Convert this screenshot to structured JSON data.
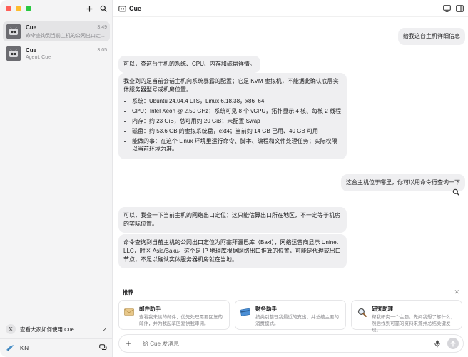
{
  "app": {
    "title": "Cue"
  },
  "sidebar": {
    "conversations": [
      {
        "title": "Cue",
        "time": "3:49",
        "preview": "命令查询到当前主机的公网出口定..."
      },
      {
        "title": "Cue",
        "time": "3:05",
        "preview": "Agent: Cue"
      }
    ],
    "share_link": {
      "label": "查看大家如何使用 Cue"
    },
    "user": {
      "name": "KiN"
    }
  },
  "chat": {
    "messages": [
      {
        "role": "user",
        "text": "给我这台主机详细信息"
      },
      {
        "role": "assistant",
        "text": "可以，查这台主机的系统、CPU、内存和磁盘详情。"
      },
      {
        "role": "assistant",
        "intro": "我查到的是当前会话主机向系统暴露的配置；它是 KVM 虚拟机，不能据此确认底层实体服务器型号或机房位置。",
        "items": [
          "系统：Ubuntu 24.04.4 LTS，Linux 6.18.38，x86_64",
          "CPU：Intel Xeon @ 2.50 GHz；系统可见 8 个 vCPU，拓扑显示 4 核、每核 2 线程",
          "内存：约 23 GiB，总可用约 20 GiB；未配置 Swap",
          "磁盘：约 53.6 GB 的虚拟系统盘，ext4；当前约 14 GB 已用、40 GB 可用",
          "能做的事：在这个 Linux 环境里运行命令、脚本、编程和文件处理任务；实际权限以当前环境为准。"
        ]
      },
      {
        "role": "user",
        "text": "这台主机位于哪里，你可以用命令行查询一下"
      },
      {
        "role": "assistant",
        "text": "可以，我查一下当前主机的网络出口定位；这只能估算出口所在地区，不一定等于机房的实际位置。"
      },
      {
        "role": "assistant",
        "text": "命令查询到当前主机的公网出口定位为阿塞拜疆巴库（Baki），网络运营商显示 Uninet LLC，时区 Asia/Baku。这个是 IP 地理库根据网络出口推算的位置，可能是代理或出口节点，不足以确认实体服务器机房就在当地。"
      }
    ]
  },
  "suggestions": {
    "title": "推荐",
    "cards": [
      {
        "name": "邮件助手",
        "desc": "查看我未读的邮件，优先处理需要回复的邮件，并为我起草回复供我审阅。",
        "icon": "mail-icon"
      },
      {
        "name": "财务助手",
        "desc": "按类别整理我最近的支出，并总结主要的消费模式。",
        "icon": "card-icon"
      },
      {
        "name": "研究助理",
        "desc": "帮我研究一个主题。先问我想了解什么，然后找到可靠的资料来源并总结关键发现。",
        "icon": "magnifier-icon"
      }
    ]
  },
  "composer": {
    "placeholder": "给 Cue 发消息"
  },
  "colors": {
    "bubble": "#efeff1",
    "sidebar": "#f4f4f5",
    "accent": "#1d1d1f"
  }
}
